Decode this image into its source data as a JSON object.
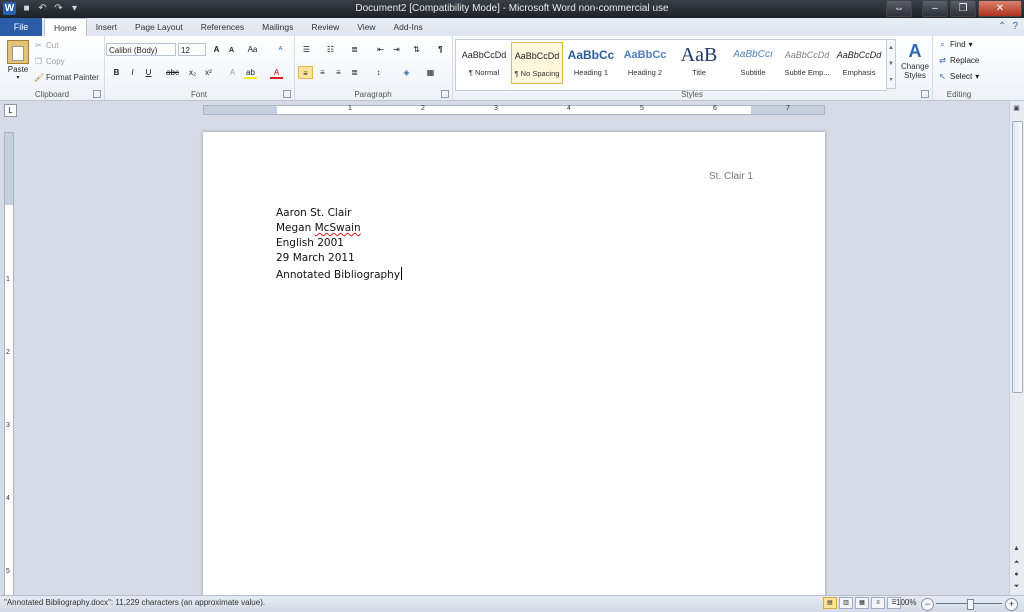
{
  "window": {
    "title": "Document2 [Compatibility Mode] - Microsoft Word non-commercial use",
    "app_icon": "W",
    "qat_icons": [
      "save-icon",
      "undo-icon",
      "redo-icon",
      "customize-icon"
    ]
  },
  "tabs": {
    "file": "File",
    "items": [
      "Home",
      "Insert",
      "Page Layout",
      "References",
      "Mailings",
      "Review",
      "View",
      "Add-Ins"
    ],
    "active": "Home"
  },
  "clipboard": {
    "paste": "Paste",
    "cut": "Cut",
    "copy": "Copy",
    "format_painter": "Format Painter",
    "label": "Clipboard"
  },
  "font": {
    "name": "Calibri (Body)",
    "size": "12",
    "grow": "A",
    "shrink": "A",
    "change_case": "Aa",
    "clear": "ᴬ",
    "bold": "B",
    "italic": "I",
    "underline": "U",
    "strike": "abc",
    "subscript": "x₂",
    "superscript": "x²",
    "effects": "A",
    "highlight": "ab",
    "font_color": "A",
    "label": "Font"
  },
  "paragraph": {
    "label": "Paragraph",
    "active_alignment": "left"
  },
  "styles": {
    "label": "Styles",
    "items": [
      {
        "sample": "AaBbCcDd",
        "name": "¶ Normal"
      },
      {
        "sample": "AaBbCcDd",
        "name": "¶ No Spacing"
      },
      {
        "sample": "AaBbCc",
        "name": "Heading 1"
      },
      {
        "sample": "AaBbCc",
        "name": "Heading 2"
      },
      {
        "sample": "AaB",
        "name": "Title"
      },
      {
        "sample": "AaBbCcı",
        "name": "Subtitle"
      },
      {
        "sample": "AaBbCcDd",
        "name": "Subtle Emp..."
      },
      {
        "sample": "AaBbCcDd",
        "name": "Emphasis"
      }
    ],
    "selected": "¶ No Spacing",
    "change_styles": "Change Styles"
  },
  "editing": {
    "find": "Find",
    "replace": "Replace",
    "select": "Select",
    "label": "Editing"
  },
  "ruler": {
    "h_numbers": [
      "1",
      "2",
      "3",
      "4",
      "5",
      "6",
      "7"
    ],
    "v_numbers": [
      "1",
      "2",
      "3",
      "4",
      "5"
    ]
  },
  "document": {
    "header": "St. Clair 1",
    "lines": [
      "Aaron St. Clair",
      "Megan McSwain",
      "English 2001",
      "29 March 2011",
      "Annotated Bibliography"
    ],
    "misspelled_word": "McSwain"
  },
  "status": {
    "text": "\"Annotated Bibliography.docx\": 11,229 characters (an approximate value).",
    "zoom": "100%"
  }
}
